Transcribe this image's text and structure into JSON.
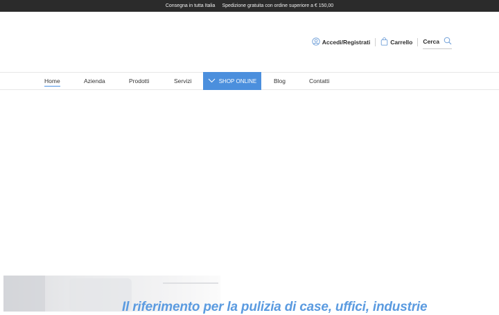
{
  "topbar": {
    "left_text": "Consegna in tutta Italia",
    "right_text": "Spedizione gratuita con ordine superiore a € 150,00"
  },
  "header": {
    "login_label": "Accedi/Registrati",
    "cart_label": "Carrello",
    "search_label": "Cerca",
    "icons": {
      "login": "user-icon",
      "cart": "shopping-bag-icon",
      "search": "search-icon"
    }
  },
  "nav": {
    "items": [
      {
        "label": "Home",
        "active": true
      },
      {
        "label": "Azienda"
      },
      {
        "label": "Prodotti"
      },
      {
        "label": "Servizi"
      },
      {
        "label": "SHOP ONLINE",
        "highlight": true
      },
      {
        "label": "Blog"
      },
      {
        "label": "Contatti"
      }
    ]
  },
  "hero": {
    "title": "Il riferimento per la pulizia di case, uffici, industrie"
  },
  "colors": {
    "accent": "#4b8fdd",
    "topbar_bg": "#2b2b2b",
    "hero_title": "#5b9be0"
  }
}
